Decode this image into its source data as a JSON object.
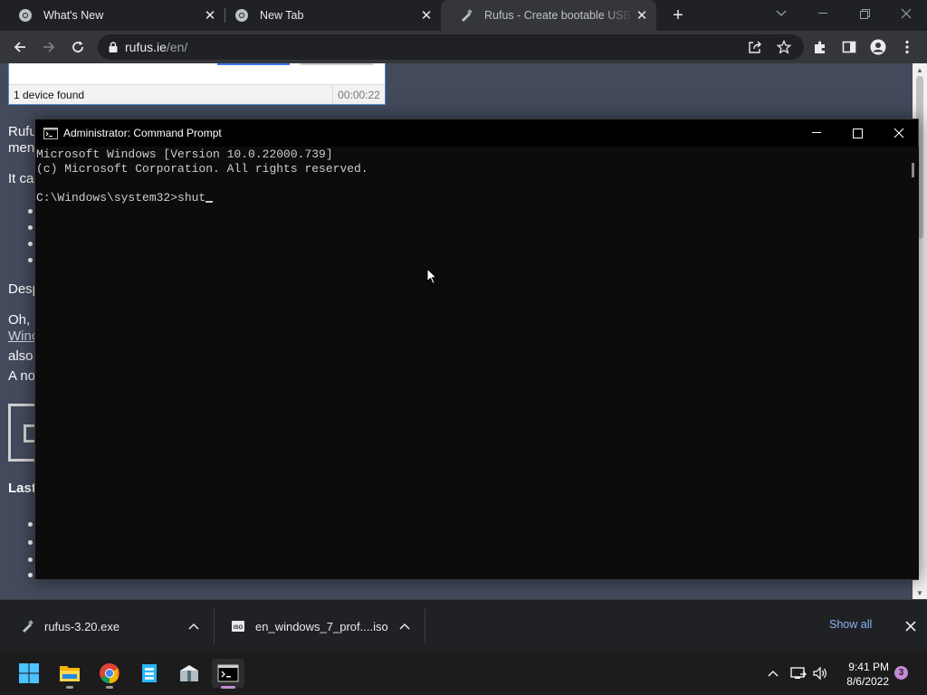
{
  "browser": {
    "tabs": [
      {
        "title": "What's New",
        "icon": "chrome-icon",
        "active": false
      },
      {
        "title": "New Tab",
        "icon": "chrome-icon",
        "active": false
      },
      {
        "title": "Rufus - Create bootable USB drives the easy way",
        "icon": "rufus-icon",
        "active": true
      }
    ],
    "url_host": "rufus.ie",
    "url_path": "/en/"
  },
  "page": {
    "rufus_status": "1 device found",
    "rufus_time": "00:00:22",
    "p1_line1": "Rufu",
    "p1_line2": "men",
    "p2": "It ca",
    "p3": "Desp",
    "p4_line1": "Oh, ",
    "p4_link": "Winc",
    "p4_line3": "also",
    "p4_line4": "A no",
    "heading": "Last"
  },
  "cmd": {
    "title": "Administrator: Command Prompt",
    "lines": [
      "Microsoft Windows [Version 10.0.22000.739]",
      "(c) Microsoft Corporation. All rights reserved.",
      "",
      "C:\\Windows\\system32>shut"
    ]
  },
  "downloads": [
    {
      "name": "rufus-3.20.exe",
      "icon": "rufus-icon"
    },
    {
      "name": "en_windows_7_prof....iso",
      "icon": "iso-file-icon"
    }
  ],
  "shelf": {
    "show_all": "Show all"
  },
  "taskbar": {
    "apps": [
      "windows-start-icon",
      "file-explorer-icon",
      "chrome-icon",
      "app-icon",
      "archive-icon",
      "terminal-icon"
    ],
    "time": "9:41 PM",
    "date": "8/6/2022",
    "notifications": "3"
  },
  "colors": {
    "page_bg": "#424a5c",
    "console_bg": "#0c0c0c",
    "console_text": "#cccccc",
    "accent": "#8ab4f8",
    "badge": "#c48ad6"
  }
}
